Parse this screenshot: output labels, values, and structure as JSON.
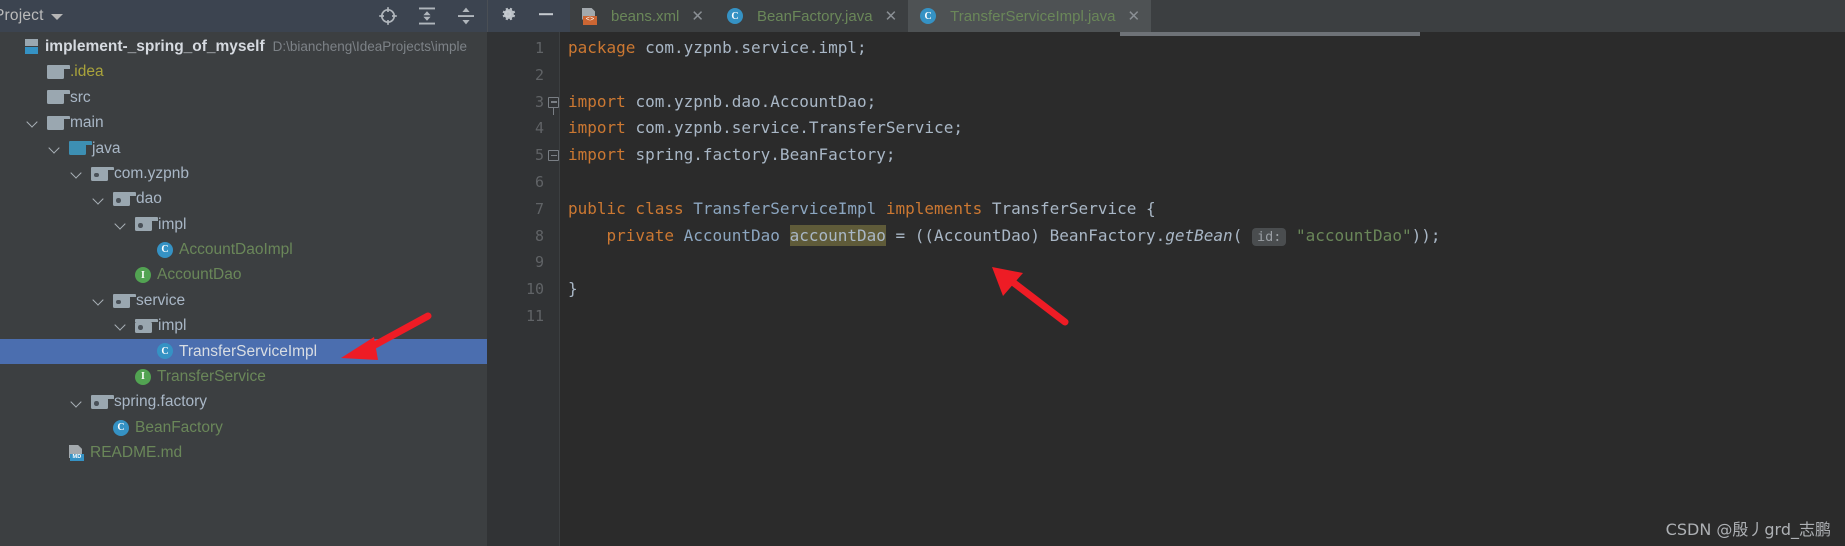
{
  "project_panel": {
    "title": "Project",
    "title_caret_icon": "chevron-down-icon",
    "toolbar_icons": [
      {
        "name": "locate-target-icon",
        "label": "Select Opened File"
      },
      {
        "name": "expand-all-icon",
        "label": "Expand All"
      },
      {
        "name": "collapse-all-icon",
        "label": "Collapse All"
      }
    ],
    "tree": [
      {
        "label": "implement-_spring_of_myself",
        "detail": "D:\\biancheng\\IdeaProjects\\imple",
        "icon": "module-icon",
        "indent": 0,
        "arrow": "none",
        "style": "bold"
      },
      {
        "label": ".idea",
        "detail": "",
        "icon": "folder-icon",
        "indent": 1,
        "arrow": "none",
        "style": "yellow"
      },
      {
        "label": "src",
        "detail": "",
        "icon": "folder-icon",
        "indent": 1,
        "arrow": "none",
        "style": "grey"
      },
      {
        "label": "main",
        "detail": "",
        "icon": "folder-icon",
        "indent": 1,
        "arrow": "open",
        "style": "grey"
      },
      {
        "label": "java",
        "detail": "",
        "icon": "source-folder-icon",
        "indent": 2,
        "arrow": "open",
        "style": "grey"
      },
      {
        "label": "com.yzpnb",
        "detail": "",
        "icon": "package-icon",
        "indent": 3,
        "arrow": "open",
        "style": "grey"
      },
      {
        "label": "dao",
        "detail": "",
        "icon": "package-icon",
        "indent": 4,
        "arrow": "open",
        "style": "grey"
      },
      {
        "label": "impl",
        "detail": "",
        "icon": "package-icon",
        "indent": 5,
        "arrow": "open",
        "style": "grey"
      },
      {
        "label": "AccountDaoImpl",
        "detail": "",
        "icon": "java-class-icon",
        "indent": 6,
        "arrow": "none",
        "style": "green"
      },
      {
        "label": "AccountDao",
        "detail": "",
        "icon": "java-interface-icon",
        "indent": 5,
        "arrow": "none",
        "style": "green"
      },
      {
        "label": "service",
        "detail": "",
        "icon": "package-icon",
        "indent": 4,
        "arrow": "open",
        "style": "grey"
      },
      {
        "label": "impl",
        "detail": "",
        "icon": "package-icon",
        "indent": 5,
        "arrow": "open",
        "style": "grey"
      },
      {
        "label": "TransferServiceImpl",
        "detail": "",
        "icon": "java-class-icon",
        "indent": 6,
        "arrow": "none",
        "style": "white",
        "selected": true
      },
      {
        "label": "TransferService",
        "detail": "",
        "icon": "java-interface-icon",
        "indent": 5,
        "arrow": "none",
        "style": "green"
      },
      {
        "label": "spring.factory",
        "detail": "",
        "icon": "package-icon",
        "indent": 3,
        "arrow": "open",
        "style": "grey"
      },
      {
        "label": "BeanFactory",
        "detail": "",
        "icon": "java-class-icon",
        "indent": 4,
        "arrow": "none",
        "style": "green"
      },
      {
        "label": "README.md",
        "detail": "",
        "icon": "markdown-file-icon",
        "indent": 2,
        "arrow": "none",
        "style": "green"
      }
    ]
  },
  "editor": {
    "left_tools": [
      {
        "name": "settings-gear-icon",
        "label": "Settings"
      },
      {
        "name": "minimize-icon",
        "label": "Hide"
      }
    ],
    "tabs": [
      {
        "label": "beans.xml",
        "icon": "xml-file-icon",
        "active": false,
        "close_icon": "close-icon"
      },
      {
        "label": "BeanFactory.java",
        "icon": "java-class-icon",
        "active": false,
        "close_icon": "close-icon"
      },
      {
        "label": "TransferServiceImpl.java",
        "icon": "java-class-icon",
        "active": true,
        "close_icon": "close-icon"
      }
    ],
    "line_numbers": [
      "1",
      "2",
      "3",
      "4",
      "5",
      "6",
      "7",
      "8",
      "9",
      "10",
      "11"
    ],
    "code_lines": [
      {
        "n": 1,
        "tokens": [
          {
            "t": "package ",
            "c": "kw"
          },
          {
            "t": "com.yzpnb.service.impl;",
            "c": "id"
          }
        ]
      },
      {
        "n": 2,
        "tokens": []
      },
      {
        "n": 3,
        "tokens": [
          {
            "t": "import ",
            "c": "kw"
          },
          {
            "t": "com.yzpnb.dao.AccountDao;",
            "c": "id"
          }
        ],
        "fold": "head"
      },
      {
        "n": 4,
        "tokens": [
          {
            "t": "import ",
            "c": "kw"
          },
          {
            "t": "com.yzpnb.service.TransferService;",
            "c": "id"
          }
        ]
      },
      {
        "n": 5,
        "tokens": [
          {
            "t": "import ",
            "c": "kw"
          },
          {
            "t": "spring.factory.BeanFactory;",
            "c": "id"
          }
        ],
        "fold": "tail"
      },
      {
        "n": 6,
        "tokens": []
      },
      {
        "n": 7,
        "tokens": [
          {
            "t": "public class ",
            "c": "kw"
          },
          {
            "t": "TransferServiceImpl ",
            "c": "cls2"
          },
          {
            "t": "implements ",
            "c": "kw"
          },
          {
            "t": "TransferService {",
            "c": "id"
          }
        ]
      },
      {
        "n": 8,
        "tokens": [
          {
            "t": "    private ",
            "c": "kw"
          },
          {
            "t": "AccountDao ",
            "c": "cls2"
          },
          {
            "t": "accountDao",
            "c": "var-hl"
          },
          {
            "t": " = ((AccountDao) ",
            "c": "id"
          },
          {
            "t": "BeanFactory.",
            "c": "id"
          },
          {
            "t": "getBean",
            "c": "meth"
          },
          {
            "t": "( ",
            "c": "id"
          },
          {
            "t": "id:",
            "c": "hint"
          },
          {
            "t": " ",
            "c": "id"
          },
          {
            "t": "\"accountDao\"",
            "c": "str"
          },
          {
            "t": "));",
            "c": "id"
          }
        ]
      },
      {
        "n": 9,
        "tokens": []
      },
      {
        "n": 10,
        "tokens": [
          {
            "t": "}",
            "c": "id"
          }
        ]
      },
      {
        "n": 11,
        "tokens": []
      }
    ]
  },
  "annotations": {
    "arrow_tree": {
      "name": "red-arrow-pointing-to-selected-class"
    },
    "arrow_code": {
      "name": "red-arrow-pointing-to-getbean-call"
    }
  },
  "watermark": {
    "text": "CSDN @殷丿grd_志鹏"
  },
  "colors": {
    "selection_blue": "#4b6eaf",
    "keyword_orange": "#cc7832",
    "string_green": "#6a8759",
    "identifier": "#a9b7c6",
    "editor_bg": "#2b2b2b",
    "panel_bg": "#3c3f41",
    "arrow_red": "#ee1c25"
  }
}
